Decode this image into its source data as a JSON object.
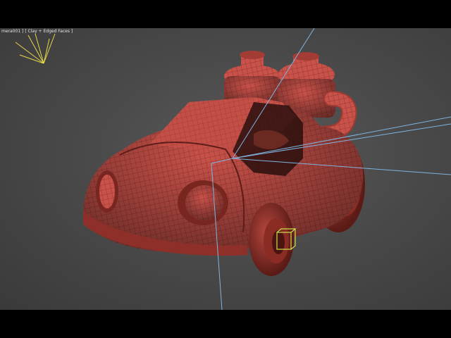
{
  "viewport": {
    "label_camera": "mera001 ]",
    "label_mode": "[ Clay + Edged Faces ]"
  },
  "colors": {
    "background": "#4a4a4a",
    "clay": "#c9524a",
    "clay_dark": "#7a2620",
    "wire": "#5e1d18",
    "light_ray": "#7fb4e0",
    "light_icon": "#e8d84a",
    "gizmo": "#c8e24a"
  },
  "icons": [
    "light-icon",
    "gizmo-box-icon"
  ]
}
